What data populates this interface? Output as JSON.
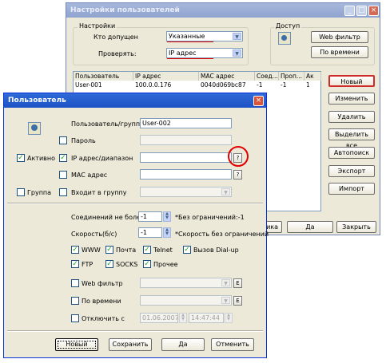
{
  "main_window": {
    "title": "Настройки пользователей",
    "settings_group": "Настройки",
    "who_allowed_label": "Кто допущен",
    "who_allowed_value": "Указанные",
    "check_label": "Проверять:",
    "check_value": "IP адрес",
    "access_group": "Доступ",
    "web_filter_button": "Web фильтр",
    "by_time_button": "По времени",
    "table": {
      "columns": [
        "Пользователь",
        "IP адрес",
        "MAC адрес",
        "Соед...",
        "Проп...",
        "Ак"
      ],
      "rows": [
        [
          "User-001",
          "100.0.0.176",
          "0040d069bc87",
          "-1",
          "-1",
          "1"
        ]
      ]
    },
    "side_buttons": {
      "new": "Новый",
      "edit": "Изменить",
      "delete": "Удалить",
      "select_all": "Выделить все",
      "autosearch": "Автопоиск",
      "export": "Экспорт",
      "import": "Импорт"
    },
    "bottom_buttons": {
      "partial": "ика",
      "ok": "Да",
      "close": "Закрыть"
    }
  },
  "dialog": {
    "title": "Пользователь",
    "user_group_label": "Пользователь/группа",
    "user_group_value": "User-002",
    "password_label": "Пароль",
    "active_label": "Активно",
    "ip_label": "IP адрес/диапазон",
    "mac_label": "MAC адрес",
    "group_label": "Группа",
    "join_group_label": "Входит в группу",
    "help_button": "?",
    "connections_label": "Соединений не более",
    "connections_value": "-1",
    "connections_hint": "*Без ограничений:-1",
    "speed_label": "Скорость(б/с)",
    "speed_value": "-1",
    "speed_hint": "*Скорость без ограничений",
    "protocols": {
      "www": "WWW",
      "mail": "Почта",
      "telnet": "Telnet",
      "dialup": "Вызов Dial-up",
      "ftp": "FTP",
      "socks": "SOCKS",
      "other": "Прочее"
    },
    "web_filter_label": "Web фильтр",
    "by_time_label": "По времени",
    "edit_button": "E",
    "disable_label": "Отключить с",
    "disable_date": "01.06.2007",
    "disable_time": "14:47:44",
    "buttons": {
      "new": "Новый",
      "save": "Сохранить",
      "ok": "Да",
      "cancel": "Отменить"
    }
  },
  "colors": {
    "annotation_red": "#e00000",
    "checkmark_green": "#21a121"
  }
}
